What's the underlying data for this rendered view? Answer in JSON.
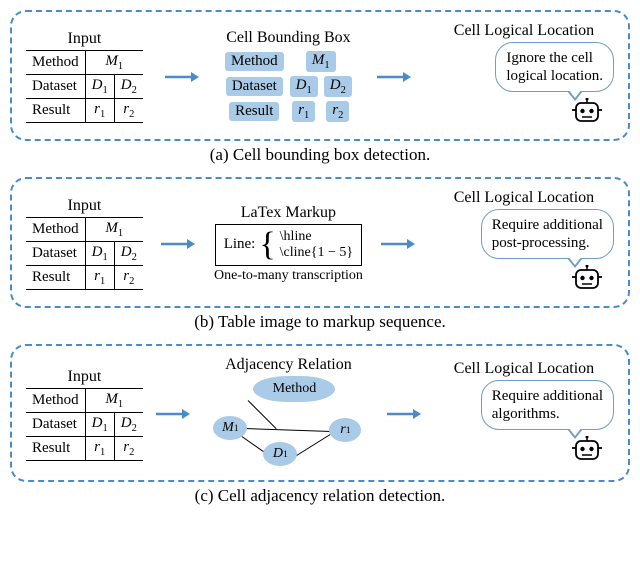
{
  "shared": {
    "input_header": "Input",
    "location_header": "Cell Logical Location",
    "table": {
      "rows": [
        {
          "label": "Method",
          "c1": "M",
          "c1sub": "1"
        },
        {
          "label": "Dataset",
          "c1": "D",
          "c1sub": "1",
          "c2": "D",
          "c2sub": "2"
        },
        {
          "label": "Result",
          "c1": "r",
          "c1sub": "1",
          "c2": "r",
          "c2sub": "2"
        }
      ]
    }
  },
  "panel_a": {
    "middle_header": "Cell Bounding Box",
    "bubble_line1": "Ignore the cell",
    "bubble_line2": "logical location.",
    "caption": "(a) Cell bounding box detection."
  },
  "panel_b": {
    "middle_header": "LaTex Markup",
    "line_label": "Line:",
    "latex1": "\\hline",
    "latex2": "\\cline{1 − 5}",
    "subtext": "One-to-many transcription",
    "bubble_line1": "Require additional",
    "bubble_line2": "post-processing.",
    "caption": "(b) Table image to markup sequence."
  },
  "panel_c": {
    "middle_header": "Adjacency Relation",
    "nodes": {
      "method": "Method",
      "m1": "M",
      "m1sub": "1",
      "d1": "D",
      "d1sub": "1",
      "r1": "r",
      "r1sub": "1"
    },
    "bubble_line1": "Require additional",
    "bubble_line2": "algorithms.",
    "caption": "(c) Cell adjacency relation detection."
  },
  "chart_data": [
    {
      "type": "table",
      "title": "Input table (panels a–c)",
      "columns": [
        "Method",
        "Dataset",
        "Result"
      ],
      "rows": [
        {
          "Method": "M1",
          "Dataset": "D1",
          "Result": "r1"
        },
        {
          "Method": "M1",
          "Dataset": "D2",
          "Result": "r2"
        }
      ]
    },
    {
      "type": "diagram",
      "title": "Cell adjacency relation graph (panel c)",
      "nodes": [
        "Method",
        "M1",
        "D1",
        "r1"
      ],
      "edges": [
        [
          "Method",
          "M1"
        ],
        [
          "M1",
          "D1"
        ],
        [
          "D1",
          "r1"
        ],
        [
          "M1",
          "r1"
        ]
      ]
    }
  ]
}
